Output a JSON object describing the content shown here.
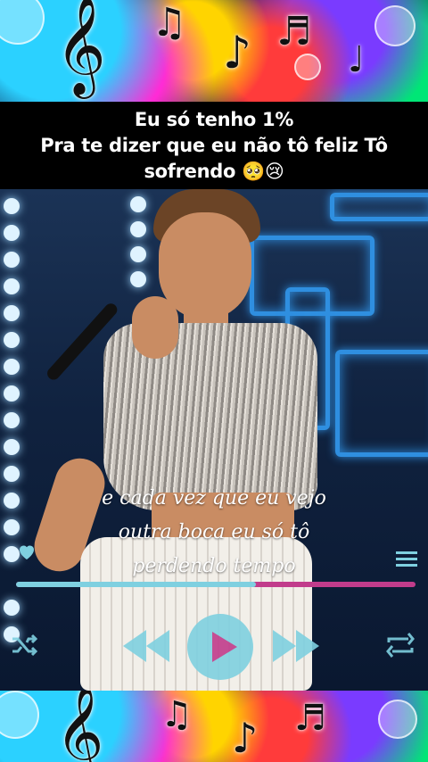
{
  "header": {
    "lines": [
      "Eu só tenho 1%",
      "Pra te dizer que eu não tô feliz Tô",
      "sofrendo 🥺😢"
    ]
  },
  "lyrics": {
    "lines": [
      "e cada vez que eu vejo",
      "outra boca eu só tô",
      "perdendo tempo"
    ]
  },
  "player": {
    "progress": 0.6,
    "icons": [
      "menu-icon",
      "rewind-icon",
      "play-icon",
      "fast-forward-icon",
      "shuffle-icon",
      "repeat-icon"
    ]
  },
  "colors": {
    "title_bg": "#000000",
    "title_text": "#ffffff",
    "progress_played": "#7fd0e0",
    "progress_remaining": "#c13c8b",
    "controls": "#7fd0e0",
    "play_triangle": "#c13c8b"
  }
}
